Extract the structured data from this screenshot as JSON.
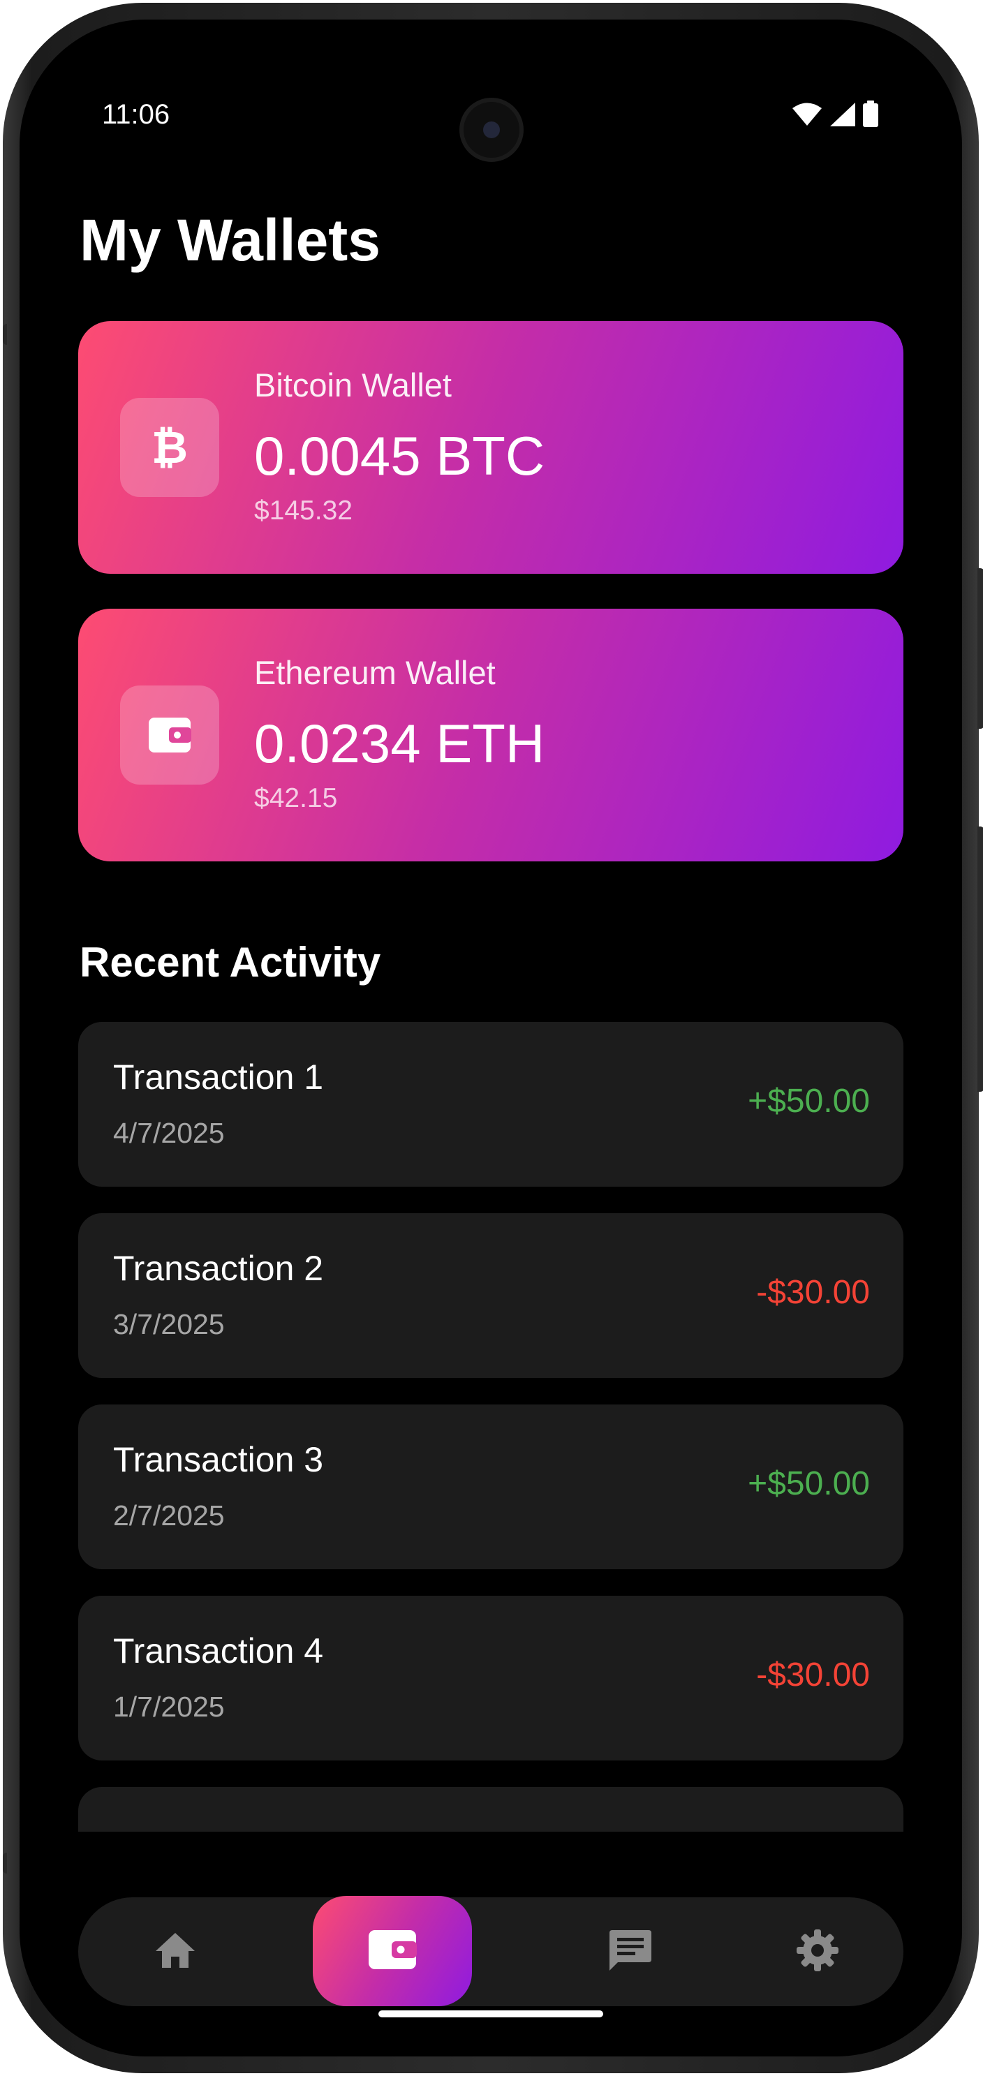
{
  "status_bar": {
    "time": "11:06",
    "icons": [
      "wifi-icon",
      "cellular-signal-icon",
      "battery-icon"
    ]
  },
  "page_title": "My Wallets",
  "wallets": [
    {
      "name": "Bitcoin Wallet",
      "amount": "0.0045 BTC",
      "fiat": "$145.32",
      "icon": "bitcoin-icon"
    },
    {
      "name": "Ethereum Wallet",
      "amount": "0.0234 ETH",
      "fiat": "$42.15",
      "icon": "wallet-icon"
    }
  ],
  "recent_activity": {
    "title": "Recent Activity",
    "transactions": [
      {
        "title": "Transaction 1",
        "date": "4/7/2025",
        "amount": "+$50.00",
        "type": "credit"
      },
      {
        "title": "Transaction 2",
        "date": "3/7/2025",
        "amount": "-$30.00",
        "type": "debit"
      },
      {
        "title": "Transaction 3",
        "date": "2/7/2025",
        "amount": "+$50.00",
        "type": "credit"
      },
      {
        "title": "Transaction 4",
        "date": "1/7/2025",
        "amount": "-$30.00",
        "type": "debit"
      }
    ]
  },
  "bottom_nav": {
    "items": [
      {
        "icon": "home-icon",
        "active": false
      },
      {
        "icon": "wallet-icon",
        "active": true
      },
      {
        "icon": "chat-icon",
        "active": false
      },
      {
        "icon": "settings-gear-icon",
        "active": false
      }
    ]
  },
  "colors": {
    "background": "#000000",
    "card_gradient_start": "#fd4c72",
    "card_gradient_end": "#8f1be0",
    "surface": "#1c1c1c",
    "credit": "#4caf50",
    "debit": "#f44336",
    "nav_icon_inactive": "#8a8a8a"
  }
}
